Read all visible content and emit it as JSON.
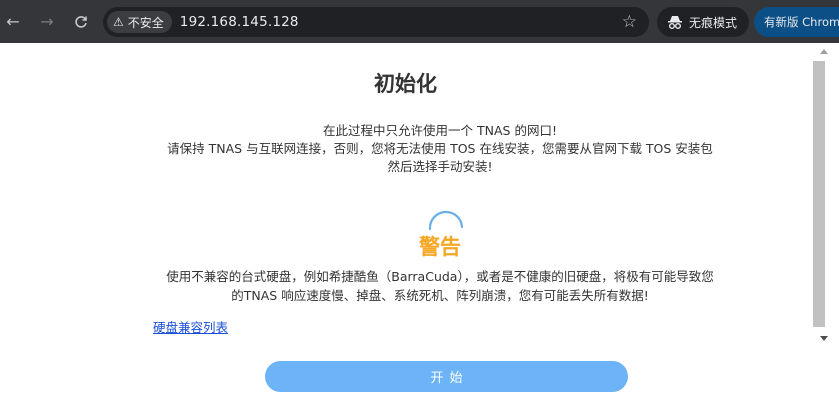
{
  "browser": {
    "security_label": "不安全",
    "url": "192.168.145.128",
    "incognito_label": "无痕模式",
    "update_label": "有新版 Chrom"
  },
  "page": {
    "title": "初始化",
    "intro_lines": [
      "在此过程中只允许使用一个 TNAS 的网口!",
      "请保持 TNAS 与互联网连接，否则，您将无法使用 TOS 在线安装，您需要从官网下载 TOS 安装包",
      "然后选择手动安装!"
    ],
    "warning_title": "警告",
    "warning_lines": [
      "使用不兼容的台式硬盘，例如希捷酷鱼（BarraCuda），或者是不健康的旧硬盘，将极有可能导致您",
      "的TNAS 响应速度慢、掉盘、系统死机、阵列崩溃，您有可能丢失所有数据!"
    ],
    "compat_link": "硬盘兼容列表",
    "start_button": "开始"
  },
  "colors": {
    "toolbar_bg": "#35363a",
    "warning": "#f5a623",
    "link": "#1a4fd8",
    "button": "#6cb4f7"
  }
}
